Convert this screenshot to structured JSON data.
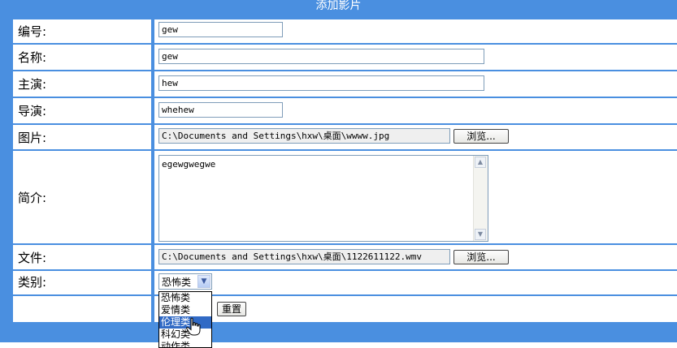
{
  "header": {
    "title": "添加影片"
  },
  "fields": {
    "code": {
      "label": "编号:",
      "value": "gew"
    },
    "name": {
      "label": "名称:",
      "value": "gew"
    },
    "starring": {
      "label": "主演:",
      "value": "hew"
    },
    "director": {
      "label": "导演:",
      "value": "whehew"
    },
    "image": {
      "label": "图片:",
      "value": "C:\\Documents and Settings\\hxw\\桌面\\wwww.jpg",
      "browse_label": "浏览..."
    },
    "intro": {
      "label": "简介:",
      "value": "egewgwegwe"
    },
    "file": {
      "label": "文件:",
      "value": "C:\\Documents and Settings\\hxw\\桌面\\1122611122.wmv",
      "browse_label": "浏览..."
    },
    "category": {
      "label": "类别:",
      "selected": "恐怖类",
      "options": [
        "恐怖类",
        "爱情类",
        "伦理类",
        "科幻类",
        "动作类"
      ],
      "highlighted": "伦理类"
    }
  },
  "actions": {
    "reset_label": "重置"
  }
}
